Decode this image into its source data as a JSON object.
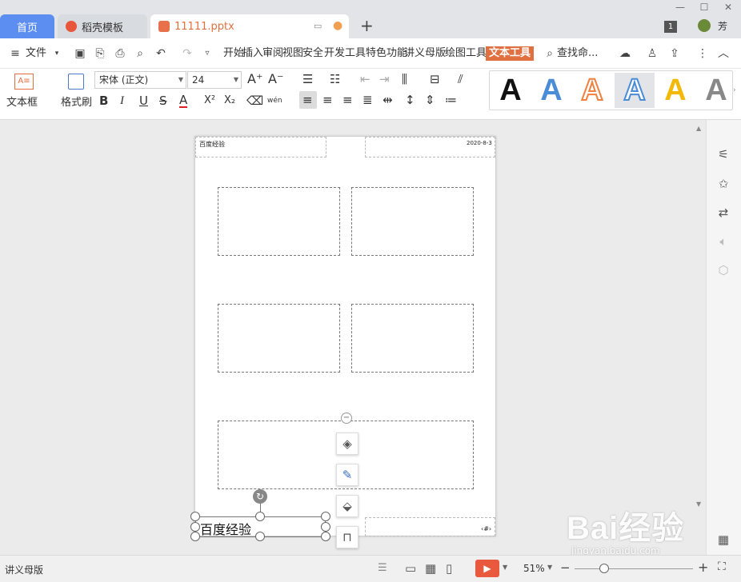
{
  "tabs": {
    "home": "首页",
    "templates": "稻壳模板",
    "file": "11111.pptx",
    "add": "+"
  },
  "window": {
    "badge": "1",
    "user": "芳",
    "minimize": "—",
    "maximize": "☐",
    "close": "✕"
  },
  "menu": {
    "file": "文件",
    "items": [
      "开始",
      "插入",
      "审阅",
      "视图",
      "安全",
      "开发工具",
      "特色功能",
      "讲义母版",
      "绘图工具"
    ],
    "active": "文本工具",
    "search": "查找命..."
  },
  "ribbon": {
    "textbox": "文本框",
    "format_painter": "格式刷",
    "font": "宋体 (正文)",
    "size": "24",
    "bold": "B",
    "italic": "I",
    "underline": "U",
    "strike": "S",
    "font_color": "A",
    "superscript": "X²",
    "subscript": "X₂",
    "phonetic": "wén",
    "style_letter": "A"
  },
  "slide": {
    "header_left": "百度经验",
    "header_right": "2020-8-3",
    "textbox_text": "百度经验"
  },
  "status": {
    "mode": "讲义母版",
    "zoom": "51%"
  },
  "watermark": {
    "brand": "Bai经验",
    "url": "jingyan.baidu.com"
  },
  "colors": {
    "accent": "#5b8ef0",
    "active_tab": "#e07040",
    "play": "#e8593d"
  }
}
